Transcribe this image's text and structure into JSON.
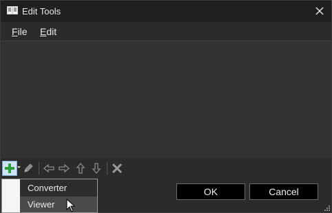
{
  "window": {
    "title": "Edit Tools"
  },
  "menu": {
    "file": {
      "mnemonic": "F",
      "rest": "ile"
    },
    "edit": {
      "mnemonic": "E",
      "rest": "dit"
    }
  },
  "toolbar": {
    "buttons": [
      "plus-icon",
      "pencil-icon",
      "arrow-left-icon",
      "arrow-right-icon",
      "arrow-up-icon",
      "arrow-down-icon",
      "delete-icon"
    ]
  },
  "dropdown": {
    "items": [
      "Converter",
      "Viewer"
    ],
    "highlighted": "Viewer"
  },
  "buttons": {
    "ok": "OK",
    "cancel": "Cancel"
  },
  "colors": {
    "accent_green": "#2e9e3a",
    "titlebar": "#202020",
    "background": "#2b2b2b"
  }
}
